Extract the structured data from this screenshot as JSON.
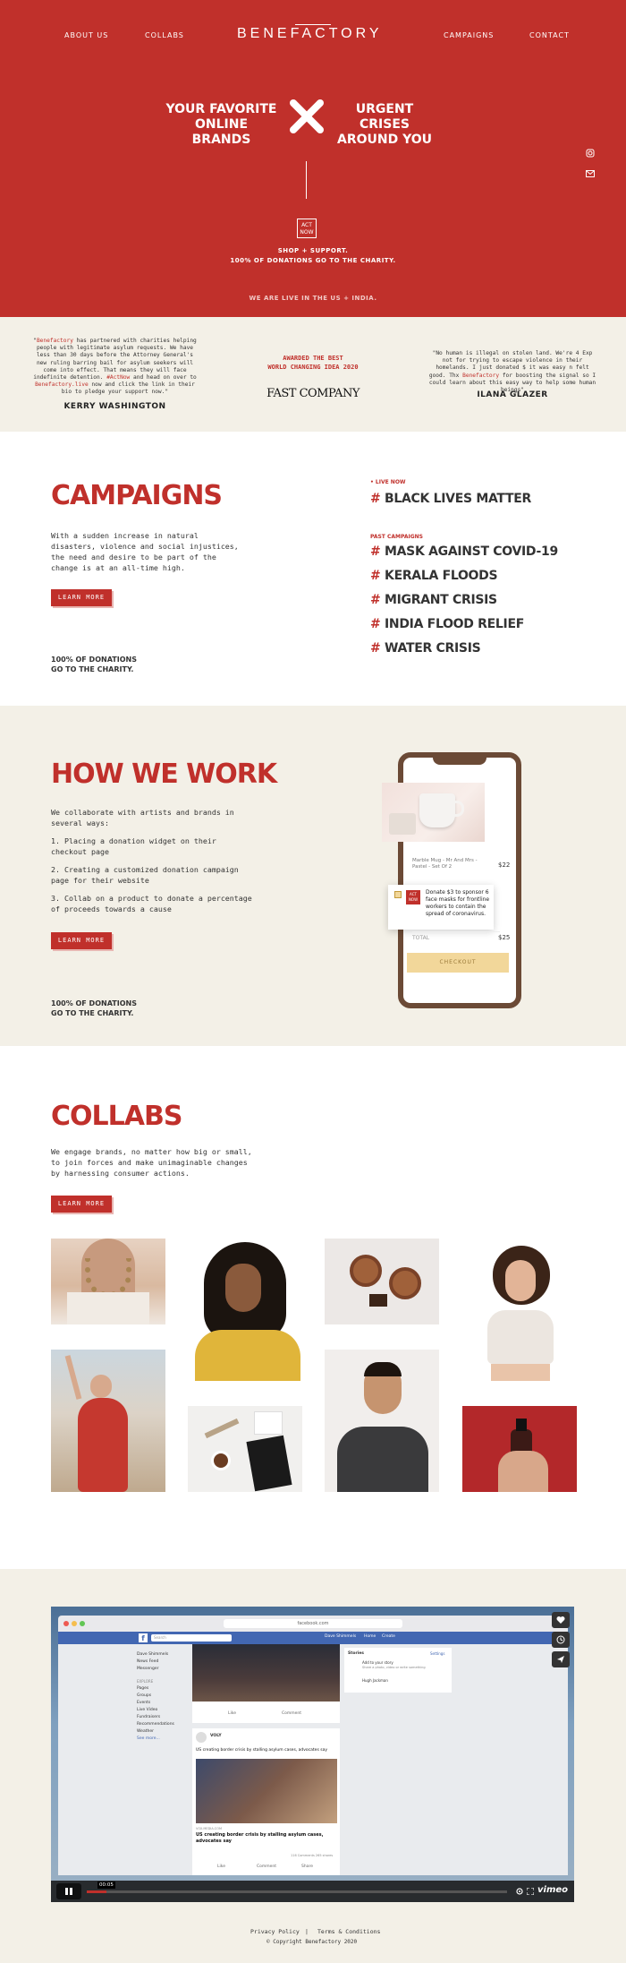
{
  "nav": {
    "about": "ABOUT US",
    "collabs": "COLLABS",
    "logo": "BENEFACTORY",
    "campaigns": "CAMPAIGNS",
    "contact": "CONTACT"
  },
  "hero": {
    "left_line1": "YOUR FAVORITE",
    "left_line2": "ONLINE BRANDS",
    "right_line1": "URGENT CRISES",
    "right_line2": "AROUND YOU",
    "badge_top": "ACT",
    "badge_bottom": "NOW",
    "shop_line1": "SHOP + SUPPORT.",
    "shop_line2": "100% OF DONATIONS GO TO THE CHARITY.",
    "live": "WE ARE LIVE IN THE US + INDIA."
  },
  "press": {
    "quote1_a": "\"",
    "quote1_brand": "Benefactory",
    "quote1_b": " has partnered with charities helping people with legitimate asylum requests. We have less than 30 days before the Attorney General's new ruling barring bail for asylum seekers will come into effect. That means they will face indefinite detention. ",
    "quote1_tag": "#ActNow",
    "quote1_c": " and head on over to ",
    "quote1_link": "Benefactory.live",
    "quote1_d": " now and click the link in their bio to pledge your support now.\"",
    "author1": "KERRY WASHINGTON",
    "award_line1": "AWARDED THE BEST",
    "award_line2": "WORLD CHANGING IDEA 2020",
    "award_logo": "FAST COMPANY",
    "quote2_a": "\"No human is illegal on stolen land. We're 4 Exp not for trying to escape violence in their homelands. I just donated $ it was easy n felt good. Thx ",
    "quote2_brand": "Benefactory",
    "quote2_b": " for boosting the signal so I could learn about this easy way to help some human beings\"",
    "author2": "ILANA GLAZER"
  },
  "campaigns": {
    "title": "CAMPAIGNS",
    "body": "With a sudden increase in natural disasters, violence and social injustices, the need and desire to be part of the change is at an all-time high.",
    "button": "LEARN MORE",
    "note_line1": "100% OF DONATIONS",
    "note_line2": "GO TO THE CHARITY.",
    "live_label": "• LIVE NOW",
    "live_items": [
      "BLACK LIVES MATTER"
    ],
    "past_label": "PAST CAMPAIGNS",
    "past_items": [
      "MASK AGAINST COVID-19",
      "KERALA FLOODS",
      "MIGRANT CRISIS",
      "INDIA FLOOD RELIEF",
      "WATER CRISIS"
    ],
    "hash": "#"
  },
  "how": {
    "title": "HOW WE WORK",
    "intro": "We collaborate with artists and brands in several ways:",
    "step1": "1. Placing a donation widget on their checkout page",
    "step2": "2. Creating a customized donation campaign page for their website",
    "step3": "3. Collab on a product to donate a percentage of proceeds towards a cause",
    "button": "LEARN MORE",
    "note_line1": "100% OF DONATIONS",
    "note_line2": "GO TO THE CHARITY.",
    "phone": {
      "product_name": "Marble Mug - Mr And Mrs - Pastel - Set Of 2",
      "product_price": "$22",
      "donate_text": "Donate $3 to sponsor 6 face masks for frontline workers to contain the spread of coronavirus.",
      "badge_top": "ACT",
      "badge_bottom": "NOW",
      "total_label": "TOTAL",
      "total_value": "$25",
      "checkout": "CHECKOUT"
    }
  },
  "collabs": {
    "title": "COLLABS",
    "body": "We engage brands, no matter how big or small, to join forces and make unimaginable changes by harnessing consumer actions.",
    "button": "LEARN MORE"
  },
  "video": {
    "url_bar": "facebook.com",
    "search": "Search",
    "nav_user": "Dave Shimmels",
    "nav_home": "Home",
    "nav_create": "Create",
    "sidebar_user": "Dave Shimmels",
    "sidebar_items": [
      "News Feed",
      "Messenger"
    ],
    "explore_label": "EXPLORE",
    "explore_items": [
      "Pages",
      "Groups",
      "Events",
      "Live Video",
      "Fundraisers",
      "Recommendations",
      "Weather",
      "See more..."
    ],
    "post1_like": "Like",
    "post1_comment": "Comment",
    "post2_brand": "VOLY",
    "post2_text": "US creating border crisis by stalling asylum cases, advocates say",
    "post2_source": "VOX.MEDIA.COM",
    "post2_headline": "US creating border crisis by stalling asylum cases, advocates say",
    "post2_stats": "116 Comments  265 shares",
    "post2_like": "Like",
    "post2_comment": "Comment",
    "post2_share": "Share",
    "right_title": "Stories",
    "right_link": "Settings",
    "right_add": "Add to your story",
    "right_add_sub": "Share a photo, video or write something",
    "right_name": "Hugh Jackman",
    "time": "00:05",
    "vimeo": "vimeo"
  },
  "footer": {
    "privacy": "Privacy Policy",
    "sep": "|",
    "terms": "Terms & Conditions",
    "copyright": "© Copyright Benefactory 2020"
  },
  "colors": {
    "brand_red": "#c0302b",
    "cream": "#f3f0e7",
    "checkout_yellow": "#f2d79a",
    "phone_frame": "#6b4a36"
  }
}
